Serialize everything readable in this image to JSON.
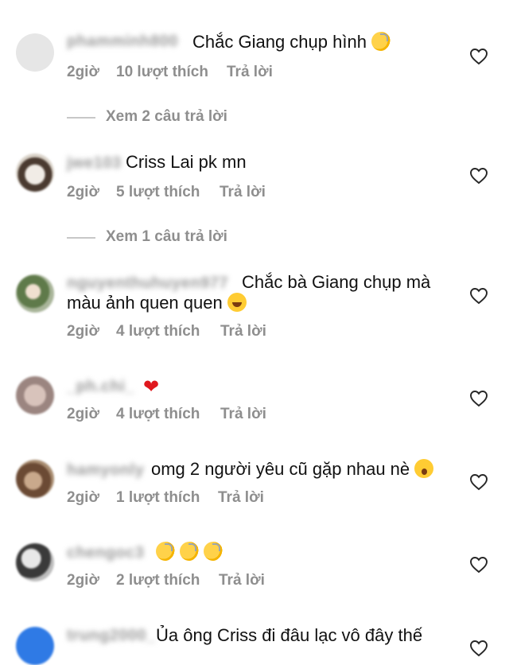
{
  "comments": [
    {
      "username": "phamminh800",
      "text": "Chắc Giang chụp hình",
      "emoji": "👏",
      "time": "2giờ",
      "likes": "10 lượt thích",
      "reply": "Trả lời",
      "replies_link": "Xem 2 câu trả lời",
      "avatar_color": "#e4e4e4"
    },
    {
      "username": "jwe103",
      "text": "Criss Lai pk mn",
      "time": "2giờ",
      "likes": "5 lượt thích",
      "reply": "Trả lời",
      "replies_link": "Xem 1 câu trả lời",
      "avatar_color": "#6e5a4a"
    },
    {
      "username": "nguyenthuhuyen977",
      "text": "Chắc bà Giang chụp mà",
      "text_line2": "màu ảnh quen quen",
      "emoji": "😂",
      "time": "2giờ",
      "likes": "4 lượt thích",
      "reply": "Trả lời",
      "avatar_color": "#7c8b6a"
    },
    {
      "username": "_ph.chi_",
      "text": "",
      "emoji": "❤️",
      "time": "2giờ",
      "likes": "4 lượt thích",
      "reply": "Trả lời",
      "avatar_color": "#b7a09a"
    },
    {
      "username": "hamyonly",
      "text": "omg 2 người yêu cũ gặp nhau nè",
      "emoji": "😮",
      "time": "2giờ",
      "likes": "1 lượt thích",
      "reply": "Trả lời",
      "avatar_color": "#8a6a52"
    },
    {
      "username": "chengoc3",
      "text": "",
      "emoji": "👏👏👏",
      "time": "2giờ",
      "likes": "2 lượt thích",
      "reply": "Trả lời",
      "avatar_color": "#555555"
    },
    {
      "username": "trung2000_",
      "text": "Ủa ông Criss đi đâu lạc vô đây thế",
      "avatar_color": "#2f7ae5"
    }
  ]
}
